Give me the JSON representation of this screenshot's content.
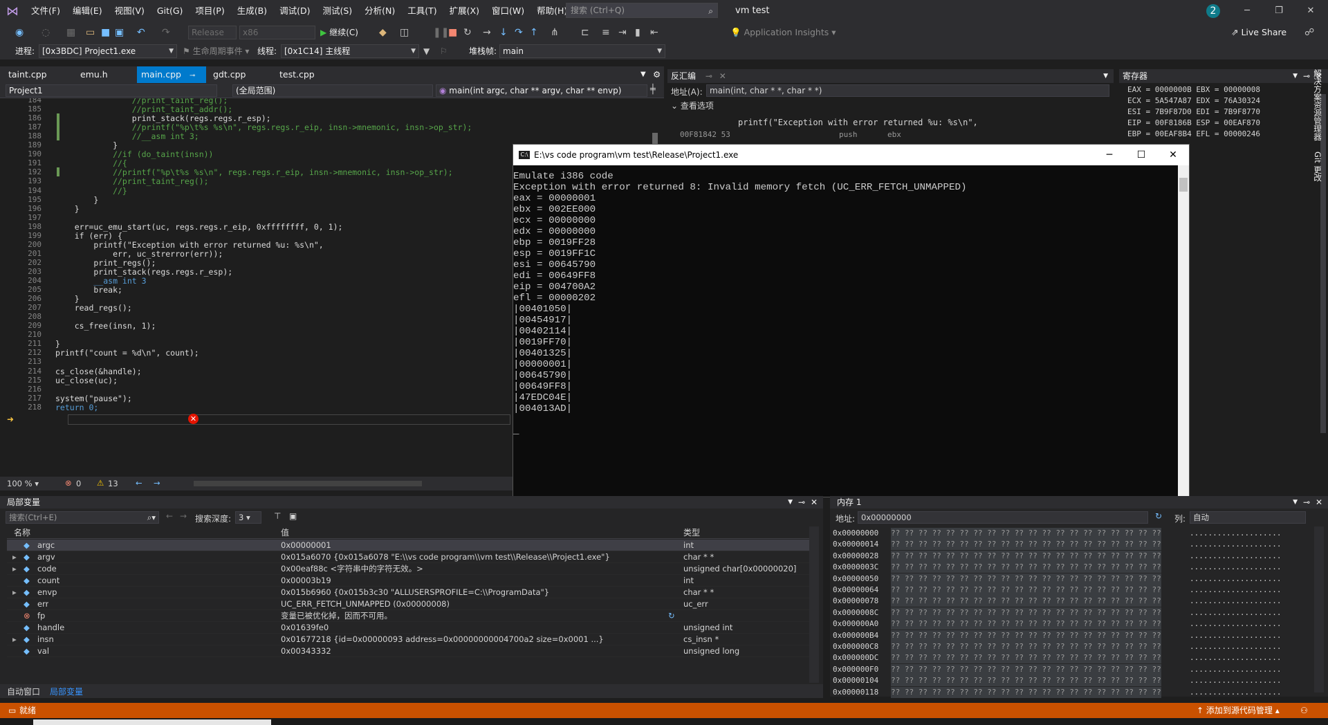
{
  "app": {
    "title": "vm test",
    "notification_count": "2",
    "menu": [
      "文件(F)",
      "编辑(E)",
      "视图(V)",
      "Git(G)",
      "项目(P)",
      "生成(B)",
      "调试(D)",
      "测试(S)",
      "分析(N)",
      "工具(T)",
      "扩展(X)",
      "窗口(W)",
      "帮助(H)"
    ],
    "search_placeholder": "搜索 (Ctrl+Q)"
  },
  "toolbar": {
    "config": "Release",
    "platform": "x86",
    "continue_label": "继续(C)",
    "app_insights": "Application Insights",
    "live_share": "Live Share"
  },
  "debugbar": {
    "process_label": "进程:",
    "process": "[0x3BDC] Project1.exe",
    "lifecycle_label": "生命周期事件",
    "thread_label": "线程:",
    "thread": "[0x1C14] 主线程",
    "stack_label": "堆栈帧:",
    "stack": "main"
  },
  "tabs": [
    {
      "label": "taint.cpp"
    },
    {
      "label": "emu.h"
    },
    {
      "label": "main.cpp"
    },
    {
      "label": "gdt.cpp"
    },
    {
      "label": "test.cpp"
    }
  ],
  "navbar": {
    "project": "Project1",
    "scope": "(全局范围)",
    "func": "main(int argc, char ** argv, char ** envp)"
  },
  "code_lines": [
    {
      "n": "184",
      "t": "                //print_taint_reg();",
      "c": "cm"
    },
    {
      "n": "185",
      "t": "                //print_taint_addr();",
      "c": "cm"
    },
    {
      "n": "186",
      "t": "                print_stack(regs.regs.r_esp);",
      "c": ""
    },
    {
      "n": "187",
      "t": "                //printf(\"%p\\t%s %s\\n\", regs.regs.r_eip, insn->mnemonic, insn->op_str);",
      "c": "cm"
    },
    {
      "n": "188",
      "t": "                //__asm int 3;",
      "c": "cm"
    },
    {
      "n": "189",
      "t": "            }",
      "c": ""
    },
    {
      "n": "190",
      "t": "            //if (do_taint(insn))",
      "c": "cm"
    },
    {
      "n": "191",
      "t": "            //{",
      "c": "cm"
    },
    {
      "n": "192",
      "t": "            //printf(\"%p\\t%s %s\\n\", regs.regs.r_eip, insn->mnemonic, insn->op_str);",
      "c": "cm"
    },
    {
      "n": "193",
      "t": "            //print_taint_reg();",
      "c": "cm"
    },
    {
      "n": "194",
      "t": "            //}",
      "c": "cm"
    },
    {
      "n": "195",
      "t": "        }",
      "c": ""
    },
    {
      "n": "196",
      "t": "    }",
      "c": ""
    },
    {
      "n": "197",
      "t": "",
      "c": ""
    },
    {
      "n": "198",
      "t": "    err=uc_emu_start(uc, regs.regs.r_eip, 0xffffffff, 0, 1);",
      "c": ""
    },
    {
      "n": "199",
      "t": "    if (err) {",
      "c": ""
    },
    {
      "n": "200",
      "t": "        printf(\"Exception with error returned %u: %s\\n\",",
      "c": ""
    },
    {
      "n": "201",
      "t": "            err, uc_strerror(err));",
      "c": ""
    },
    {
      "n": "202",
      "t": "        print_regs();",
      "c": ""
    },
    {
      "n": "203",
      "t": "        print_stack(regs.regs.r_esp);",
      "c": ""
    },
    {
      "n": "204",
      "t": "        __asm int 3",
      "c": "kw"
    },
    {
      "n": "205",
      "t": "        break;",
      "c": ""
    },
    {
      "n": "206",
      "t": "    }",
      "c": ""
    },
    {
      "n": "207",
      "t": "    read_regs();",
      "c": ""
    },
    {
      "n": "208",
      "t": "",
      "c": ""
    },
    {
      "n": "209",
      "t": "    cs_free(insn, 1);",
      "c": ""
    },
    {
      "n": "210",
      "t": "",
      "c": ""
    },
    {
      "n": "211",
      "t": "}",
      "c": ""
    },
    {
      "n": "212",
      "t": "printf(\"count = %d\\n\", count);",
      "c": ""
    },
    {
      "n": "213",
      "t": "",
      "c": ""
    },
    {
      "n": "214",
      "t": "cs_close(&handle);",
      "c": ""
    },
    {
      "n": "215",
      "t": "uc_close(uc);",
      "c": ""
    },
    {
      "n": "216",
      "t": "",
      "c": ""
    },
    {
      "n": "217",
      "t": "system(\"pause\");",
      "c": ""
    },
    {
      "n": "218",
      "t": "return 0;",
      "c": "kw"
    }
  ],
  "editor_status": {
    "zoom": "100 %",
    "errors": "0",
    "warnings": "13"
  },
  "disasm": {
    "title": "反汇编",
    "address_label": "地址(A):",
    "address": "main(int, char * *, char * *)",
    "options": "查看选项",
    "line1": "printf(\"Exception with error returned %u: %s\\n\",",
    "line2_addr": "00F81842 53",
    "line2_op": "push",
    "line2_arg": "ebx"
  },
  "registers": {
    "title": "寄存器",
    "lines": [
      "EAX = 0000000B EBX = 00000008",
      "ECX = 5A547A87 EDX = 76A30324",
      "ESI = 7B9F87D0 EDI = 7B9F8770",
      "EIP = 00F8186B ESP = 00EAF870",
      "EBP = 00EAF8B4 EFL = 00000246"
    ]
  },
  "console": {
    "title": "E:\\vs code program\\vm test\\Release\\Project1.exe",
    "lines": [
      "Emulate i386 code",
      "Exception with error returned 8: Invalid memory fetch (UC_ERR_FETCH_UNMAPPED)",
      "eax = 00000001",
      "ebx = 002EE000",
      "ecx = 00000000",
      "edx = 00000000",
      "ebp = 0019FF28",
      "esp = 0019FF1C",
      "esi = 00645790",
      "edi = 00649FF8",
      "eip = 004700A2",
      "efl = 00000202",
      "|00401050|",
      "|00454917|",
      "|00402114|",
      "|0019FF70|",
      "|00401325|",
      "|00000001|",
      "|00645790|",
      "|00649FF8|",
      "|47EDC04E|",
      "|004013AD|",
      "",
      "_"
    ]
  },
  "locals": {
    "title": "局部变量",
    "search_placeholder": "搜索(Ctrl+E)",
    "depth_label": "搜索深度:",
    "depth": "3",
    "col_name": "名称",
    "col_value": "值",
    "col_type": "类型",
    "rows": [
      {
        "name": "argc",
        "value": "0x00000001",
        "type": "int",
        "expand": ""
      },
      {
        "name": "argv",
        "value": "0x015a6070 {0x015a6078 \"E:\\\\vs code program\\\\vm test\\\\Release\\\\Project1.exe\"}",
        "type": "char * *",
        "expand": "▸"
      },
      {
        "name": "code",
        "value": "0x00eaf88c <字符串中的字符无效。>",
        "type": "unsigned char[0x00000020]",
        "expand": "▸"
      },
      {
        "name": "count",
        "value": "0x00003b19",
        "type": "int",
        "expand": ""
      },
      {
        "name": "envp",
        "value": "0x015b6960 {0x015b3c30 \"ALLUSERSPROFILE=C:\\\\ProgramData\"}",
        "type": "char * *",
        "expand": "▸"
      },
      {
        "name": "err",
        "value": "UC_ERR_FETCH_UNMAPPED (0x00000008)",
        "type": "uc_err",
        "expand": ""
      },
      {
        "name": "fp",
        "value": "变量已被优化掉，因而不可用。",
        "type": "",
        "expand": ""
      },
      {
        "name": "handle",
        "value": "0x01639fe0",
        "type": "unsigned int",
        "expand": ""
      },
      {
        "name": "insn",
        "value": "0x01677218 {id=0x00000093 address=0x00000000004700a2 size=0x0001 ...}",
        "type": "cs_insn *",
        "expand": "▸"
      },
      {
        "name": "val",
        "value": "0x00343332",
        "type": "unsigned long",
        "expand": ""
      }
    ],
    "bottom_tabs": [
      "自动窗口",
      "局部变量"
    ]
  },
  "memory": {
    "title": "内存 1",
    "address_label": "地址:",
    "address": "0x00000000",
    "columns_label": "列:",
    "columns": "自动",
    "rows": [
      "0x00000000",
      "0x00000014",
      "0x00000028",
      "0x0000003C",
      "0x00000050",
      "0x00000064",
      "0x00000078",
      "0x0000008C",
      "0x000000A0",
      "0x000000B4",
      "0x000000C8",
      "0x000000DC",
      "0x000000F0",
      "0x00000104",
      "0x00000118"
    ],
    "bytes": "?? ?? ?? ?? ?? ?? ?? ?? ?? ?? ?? ?? ?? ?? ?? ?? ?? ?? ?? ??",
    "ascii": "...................."
  },
  "status": {
    "ready": "就绪",
    "source_control": "添加到源代码管理"
  },
  "side_tabs": [
    "解决方案资源管理器",
    "Git 更改"
  ]
}
